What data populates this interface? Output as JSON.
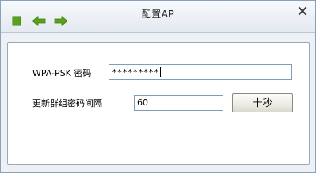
{
  "window": {
    "title": "配置AP"
  },
  "toolbar": {
    "icons": [
      "stop-icon",
      "back-arrow-icon",
      "forward-arrow-icon"
    ],
    "icon_color": "#5aa11c"
  },
  "form": {
    "psk_label": "WPA-PSK 密码",
    "psk_value": "*********",
    "interval_label": "更新群组密码间隔",
    "interval_value": "60",
    "interval_unit_button": "十秒"
  },
  "colors": {
    "window_bg": "#edf1f6",
    "panel_bg": "#ffffff",
    "input_border": "#7f9db9"
  }
}
